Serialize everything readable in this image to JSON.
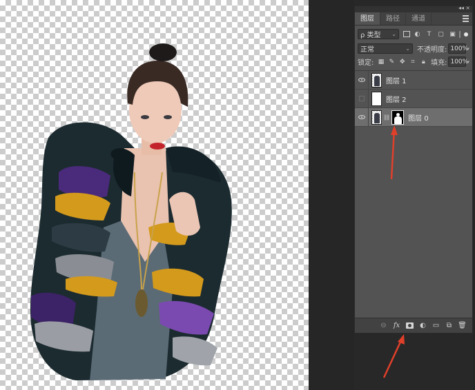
{
  "panel": {
    "tabs": [
      "图层",
      "路径",
      "通道"
    ],
    "active_tab": "图层",
    "filter": {
      "value": "ρ 类型"
    },
    "blend_mode": "正常",
    "opacity_label": "不透明度:",
    "opacity_value": "100%",
    "lock_label": "锁定:",
    "fill_label": "填充:",
    "fill_value": "100%",
    "layers": [
      {
        "name": "图层 1",
        "visible": true,
        "selected": false,
        "thumb": "person",
        "mask": false
      },
      {
        "name": "图层 2",
        "visible": false,
        "selected": false,
        "thumb": "white",
        "mask": false
      },
      {
        "name": "图层 0",
        "visible": true,
        "selected": true,
        "thumb": "person",
        "mask": true
      }
    ],
    "footer_icons": [
      "link-icon",
      "fx-icon",
      "add-mask-icon",
      "adjustment-icon",
      "folder-icon",
      "new-layer-icon",
      "trash-icon"
    ]
  },
  "annotation_color": "#e0402a"
}
